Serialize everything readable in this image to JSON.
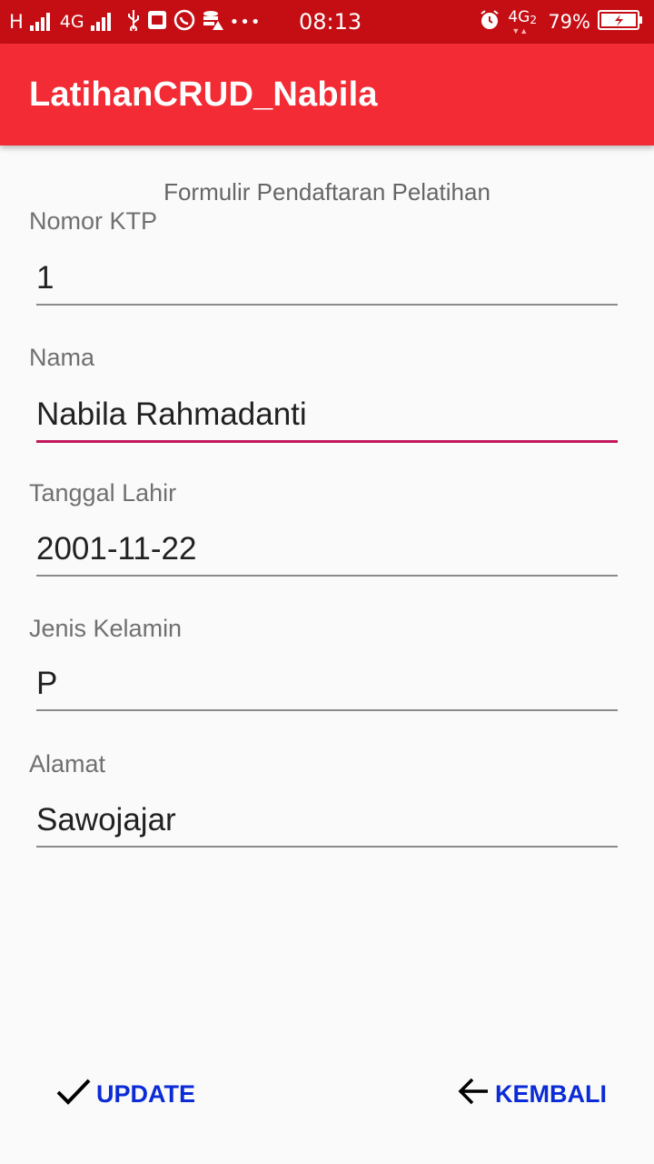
{
  "status_bar": {
    "network_type": "H",
    "network_4g": "4G",
    "time": "08:13",
    "more": "•••",
    "network_4g2": "4G",
    "network_4g2_sub": "2",
    "battery": "79%"
  },
  "app_bar": {
    "title": "LatihanCRUD_Nabila"
  },
  "form": {
    "title": "Formulir Pendaftaran Pelatihan",
    "fields": [
      {
        "label": "Nomor KTP",
        "value": "1"
      },
      {
        "label": "Nama",
        "value": "Nabila Rahmadanti"
      },
      {
        "label": "Tanggal Lahir",
        "value": "2001-11-22"
      },
      {
        "label": "Jenis Kelamin",
        "value": "P"
      },
      {
        "label": "Alamat",
        "value": "Sawojajar"
      }
    ]
  },
  "buttons": {
    "update": {
      "label": "UPDATE",
      "icon": "check-icon"
    },
    "kembali": {
      "label": "KEMBALI",
      "icon": "arrow-left-icon"
    }
  },
  "colors": {
    "status_bar": "#c50e14",
    "app_bar": "#f22b34",
    "focus_underline": "#c2185b",
    "button_text": "#0b2bd6"
  }
}
